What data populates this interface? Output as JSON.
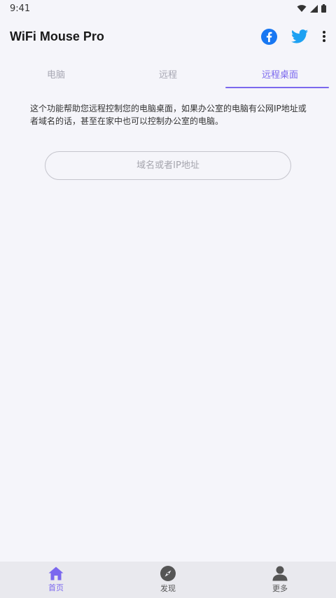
{
  "status_bar": {
    "time": "9:41"
  },
  "app_bar": {
    "title": "WiFi Mouse Pro",
    "facebook_icon": "facebook-icon",
    "twitter_icon": "twitter-icon",
    "more_icon": "more-vert-icon"
  },
  "tabs": [
    {
      "label": "电脑",
      "active": false
    },
    {
      "label": "远程",
      "active": false
    },
    {
      "label": "远程桌面",
      "active": true
    }
  ],
  "main": {
    "description": "这个功能帮助您远程控制您的电脑桌面，如果办公室的电脑有公网IP地址或者域名的话，甚至在家中也可以控制办公室的电脑。",
    "host_input": {
      "value": "",
      "placeholder": "域名或者IP地址"
    }
  },
  "bottom_nav": [
    {
      "label": "首页",
      "icon": "home-icon",
      "active": true
    },
    {
      "label": "发现",
      "icon": "compass-icon",
      "active": false
    },
    {
      "label": "更多",
      "icon": "person-icon",
      "active": false
    }
  ],
  "colors": {
    "accent": "#7b68ee",
    "facebook": "#1877f2",
    "twitter": "#1da1f2",
    "background": "#f5f5fa",
    "bottom_nav_bg": "#e9e9ee"
  }
}
